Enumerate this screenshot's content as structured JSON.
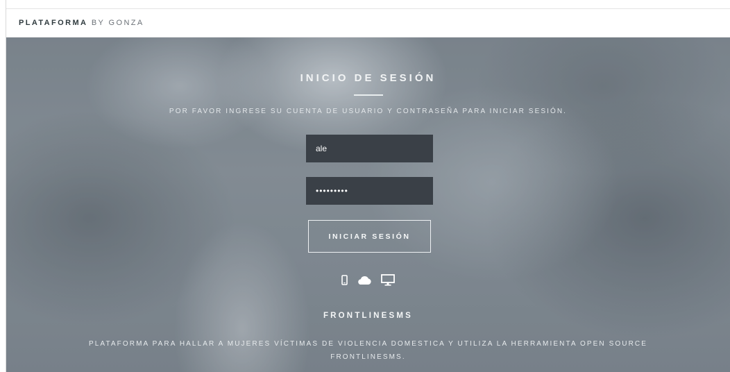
{
  "header": {
    "brand_strong": "PLATAFORMA",
    "brand_light": " BY GONZA"
  },
  "login": {
    "title": "INICIO DE SESIÓN",
    "subtitle": "POR FAVOR INGRESE SU CUENTA DE USUARIO Y CONTRASEÑA PARA INICIAR SESIÓN.",
    "username_value": "ale",
    "password_value": "•••••••••",
    "submit_label": "INICIAR SESIÓN"
  },
  "icons": [
    "mobile-icon",
    "cloud-icon",
    "desktop-icon"
  ],
  "footer": {
    "title": "FRONTLINESMS",
    "description": "PLATAFORMA PARA HALLAR A MUJERES VÍCTIMAS DE VIOLENCIA DOMESTICA Y UTILIZA LA HERRAMIENTA OPEN SOURCE FRONTLINESMS."
  },
  "colors": {
    "input_bg": "#3a4047",
    "text_light": "#ffffff",
    "hero_tint": "#848d95"
  }
}
